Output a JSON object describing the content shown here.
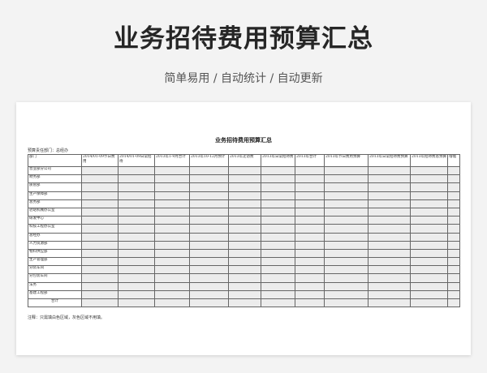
{
  "header": {
    "title": "业务招待费用预算汇总",
    "subtitle": "简单易用 / 自动统计 / 自动更新"
  },
  "sheet": {
    "title": "业务招待费用预算汇总",
    "dept_line": "预算责任部门：总经办",
    "columns": [
      "部门",
      "2014/01-09节日费用",
      "2014/01-09日常招待",
      "2013年1-9月合计",
      "2013年10-12月预计",
      "2013年走访费",
      "2013年日常招待费",
      "2013年合计",
      "2013年节日费用预算",
      "2013年日常招待费预算",
      "2013年招待费总预算",
      "增幅"
    ],
    "rows": [
      "营业部分公司",
      "财务部",
      "质管部",
      "生产保障部",
      "总务部",
      "驻站机械办公室",
      "研发中心",
      "科技工程办公室",
      "总经办",
      "人力资源部",
      "物料供应部",
      "生产管理部",
      "分装车间",
      "分包装车间",
      "法务",
      "基建工程部"
    ],
    "total_label": "合计",
    "note": "注释：只需填白色区域，灰色区域不用填。"
  }
}
